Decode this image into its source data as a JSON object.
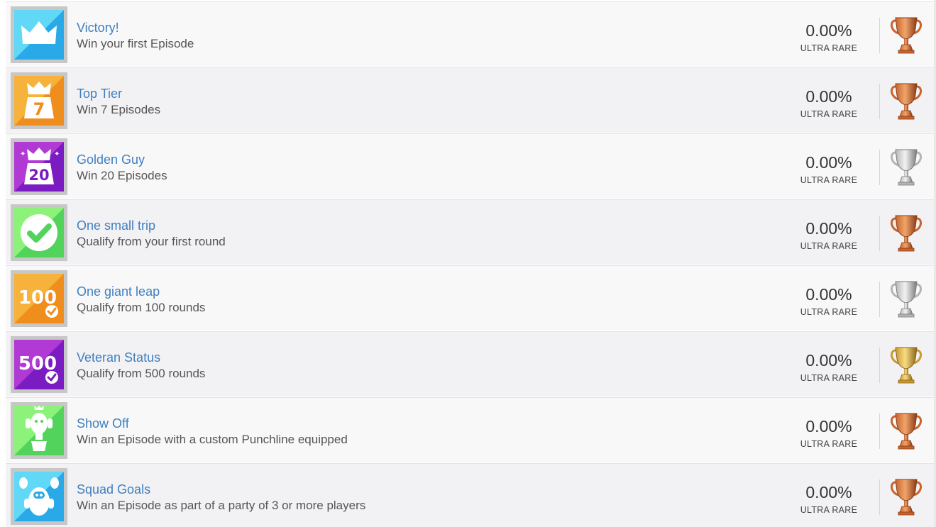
{
  "trophies": [
    {
      "title": "Victory!",
      "description": "Win your first Episode",
      "percent": "0.00%",
      "rarity": "ULTRA RARE",
      "grade": "bronze",
      "icon": "crown-icon",
      "icon_label": "",
      "icon_colors": [
        "#62d8f7",
        "#2aa9e8"
      ]
    },
    {
      "title": "Top Tier",
      "description": "Win 7 Episodes",
      "percent": "0.00%",
      "rarity": "ULTRA RARE",
      "grade": "bronze",
      "icon": "crown-podium-icon",
      "icon_label": "7",
      "icon_colors": [
        "#f7b23b",
        "#ef8d1d"
      ]
    },
    {
      "title": "Golden Guy",
      "description": "Win 20 Episodes",
      "percent": "0.00%",
      "rarity": "ULTRA RARE",
      "grade": "silver",
      "icon": "crown-podium-icon",
      "icon_label": "20",
      "icon_colors": [
        "#b13ad4",
        "#7a1cc2"
      ]
    },
    {
      "title": "One small trip",
      "description": "Qualify from your first round",
      "percent": "0.00%",
      "rarity": "ULTRA RARE",
      "grade": "bronze",
      "icon": "checkmark-circle-icon",
      "icon_label": "",
      "icon_colors": [
        "#8df27a",
        "#52d35b"
      ]
    },
    {
      "title": "One giant leap",
      "description": "Qualify from 100 rounds",
      "percent": "0.00%",
      "rarity": "ULTRA RARE",
      "grade": "silver",
      "icon": "number-check-icon",
      "icon_label": "100",
      "icon_colors": [
        "#f7b23b",
        "#ef8d1d"
      ]
    },
    {
      "title": "Veteran Status",
      "description": "Qualify from 500 rounds",
      "percent": "0.00%",
      "rarity": "ULTRA RARE",
      "grade": "gold",
      "icon": "number-check-icon",
      "icon_label": "500",
      "icon_colors": [
        "#b13ad4",
        "#7a1cc2"
      ]
    },
    {
      "title": "Show Off",
      "description": "Win an Episode with a custom Punchline equipped",
      "percent": "0.00%",
      "rarity": "ULTRA RARE",
      "grade": "bronze",
      "icon": "bean-on-podium-icon",
      "icon_label": "",
      "icon_colors": [
        "#8df27a",
        "#52d35b"
      ]
    },
    {
      "title": "Squad Goals",
      "description": "Win an Episode as part of a party of 3 or more players",
      "percent": "0.00%",
      "rarity": "ULTRA RARE",
      "grade": "bronze",
      "icon": "bean-squad-icon",
      "icon_label": "",
      "icon_colors": [
        "#62d8f7",
        "#2aa9e8"
      ]
    }
  ],
  "trophy_colors": {
    "bronze": [
      "#f0a56b",
      "#c8642c",
      "#8a3a14"
    ],
    "silver": [
      "#f2f2f2",
      "#b5b5b5",
      "#7a7a7a"
    ],
    "gold": [
      "#f6dc84",
      "#c99a2e",
      "#8a6414"
    ]
  }
}
